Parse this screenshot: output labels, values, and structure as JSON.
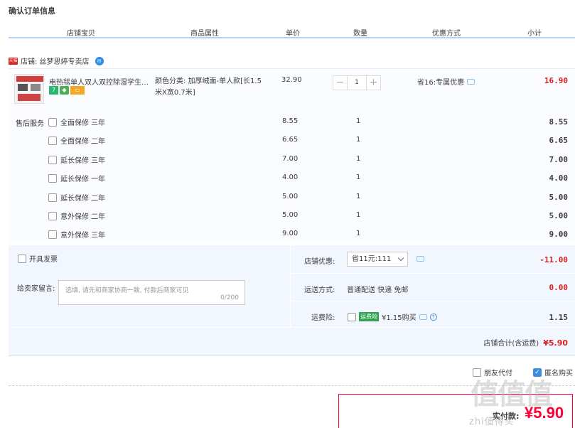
{
  "page": {
    "title": "确认订单信息"
  },
  "columns": [
    "店铺宝贝",
    "商品属性",
    "单价",
    "数量",
    "优惠方式",
    "小计"
  ],
  "shop": {
    "badge": "天猫",
    "label": "店铺: 丝梦思婷专卖店"
  },
  "item": {
    "name": "电热毯单人双人双控除湿学生宿...",
    "sku": "颜色分类: 加厚绒面-单人款[长1.5米X宽0.7米]",
    "price": "32.90",
    "qty": "1",
    "discount": "省16:专属优惠",
    "subtotal": "16.90"
  },
  "after_sales": {
    "label": "售后服务",
    "options": [
      {
        "name": "全面保修 三年",
        "price": "8.55",
        "qty": "1",
        "subtotal": "8.55"
      },
      {
        "name": "全面保修 二年",
        "price": "6.65",
        "qty": "1",
        "subtotal": "6.65"
      },
      {
        "name": "延长保修 三年",
        "price": "7.00",
        "qty": "1",
        "subtotal": "7.00"
      },
      {
        "name": "延长保修 一年",
        "price": "4.00",
        "qty": "1",
        "subtotal": "4.00"
      },
      {
        "name": "延长保修 二年",
        "price": "5.00",
        "qty": "1",
        "subtotal": "5.00"
      },
      {
        "name": "意外保修 二年",
        "price": "5.00",
        "qty": "1",
        "subtotal": "5.00"
      },
      {
        "name": "意外保修 三年",
        "price": "9.00",
        "qty": "1",
        "subtotal": "9.00"
      }
    ]
  },
  "invoice": {
    "label": "开具发票"
  },
  "message": {
    "label": "给卖家留言:",
    "placeholder": "选填, 请先和商家协商一致, 付款后商家可见",
    "count": "0/200"
  },
  "shop_discount": {
    "label": "店铺优惠:",
    "value": "省11元:111",
    "amount": "-11.00"
  },
  "shipping": {
    "label": "运送方式:",
    "value": "普通配送 快递 免邮",
    "amount": "0.00"
  },
  "insurance": {
    "label": "运费险:",
    "badge": "运费险",
    "value": "¥1.15购买",
    "amount": "1.15"
  },
  "shop_total": {
    "label": "店铺合计(含运费)",
    "value": "¥5.90"
  },
  "options": {
    "friend_pay": "朋友代付",
    "anonymous": "匿名购买"
  },
  "payment": {
    "label": "实付款:",
    "amount": "¥5.90"
  },
  "watermark": {
    "text": "zhi值得买"
  },
  "colors": {
    "accent": "#3e8ee0",
    "price_red": "#d9211f",
    "pay_red": "#ff0036",
    "panel_bg": "#f2f7ff"
  }
}
